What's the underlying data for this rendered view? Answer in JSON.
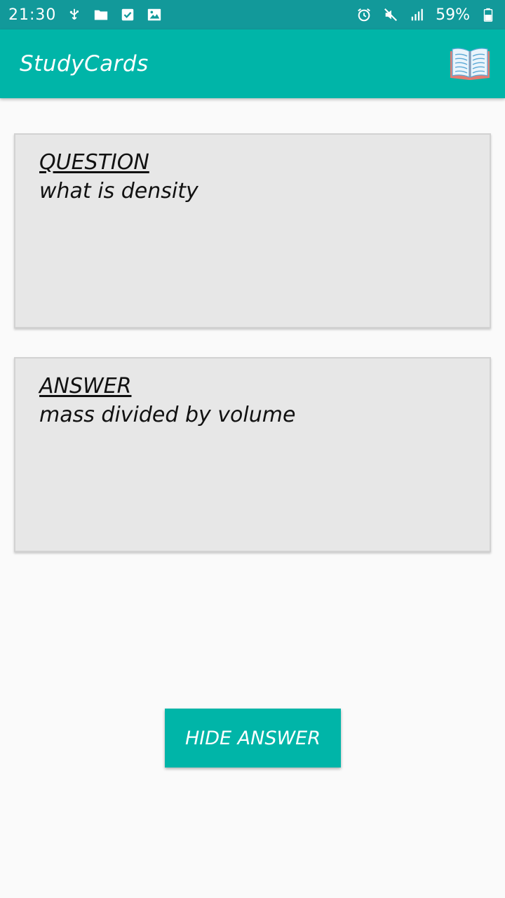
{
  "status_bar": {
    "time": "21:30",
    "battery": "59%",
    "icons": [
      "usb-icon",
      "folder-icon",
      "checkbox-icon",
      "image-icon",
      "alarm-icon",
      "mute-icon",
      "signal-icon",
      "battery-icon"
    ]
  },
  "app_bar": {
    "title": "StudyCards",
    "icon": "book-icon"
  },
  "question_card": {
    "heading": "QUESTION",
    "text": "what is density"
  },
  "answer_card": {
    "heading": "ANSWER",
    "text": "mass divided by volume"
  },
  "hide_button": {
    "label": "HIDE ANSWER"
  },
  "colors": {
    "status_bar": "#12999a",
    "primary": "#00b5a8",
    "card_background": "#e7e7e7",
    "page_background": "#fafafa"
  }
}
